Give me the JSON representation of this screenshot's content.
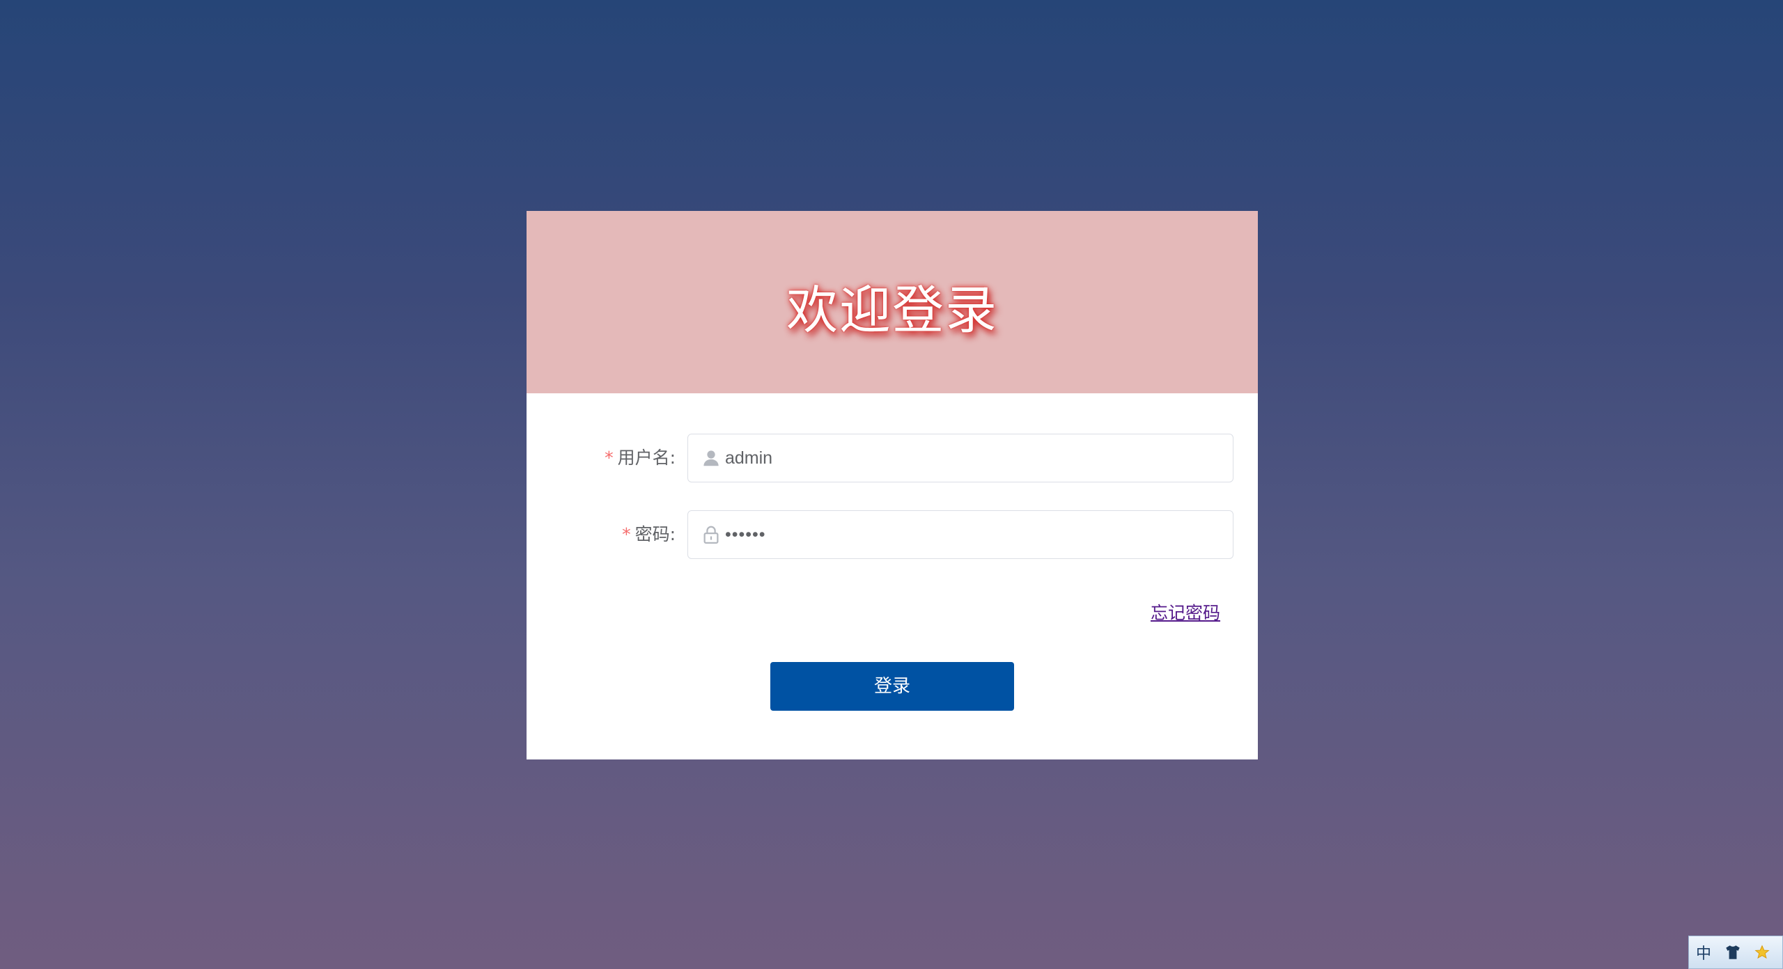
{
  "header": {
    "title": "欢迎登录"
  },
  "form": {
    "username": {
      "label": "用户名:",
      "required_mark": "*",
      "value": "admin",
      "icon": "user-icon"
    },
    "password": {
      "label": "密码:",
      "required_mark": "*",
      "value": "••••••",
      "icon": "lock-icon"
    },
    "forgot_link": "忘记密码",
    "submit_label": "登录"
  },
  "ime_toolbar": {
    "mode": "中",
    "icons": [
      "shirt-icon",
      "star-icon"
    ]
  },
  "colors": {
    "background_top": "#264577",
    "background_bottom": "#705d80",
    "header_bg": "#e4b9b9",
    "title_shadow": "#e0302c",
    "button_bg": "#0052a3",
    "required": "#f56c6c",
    "link": "#551a8b"
  }
}
